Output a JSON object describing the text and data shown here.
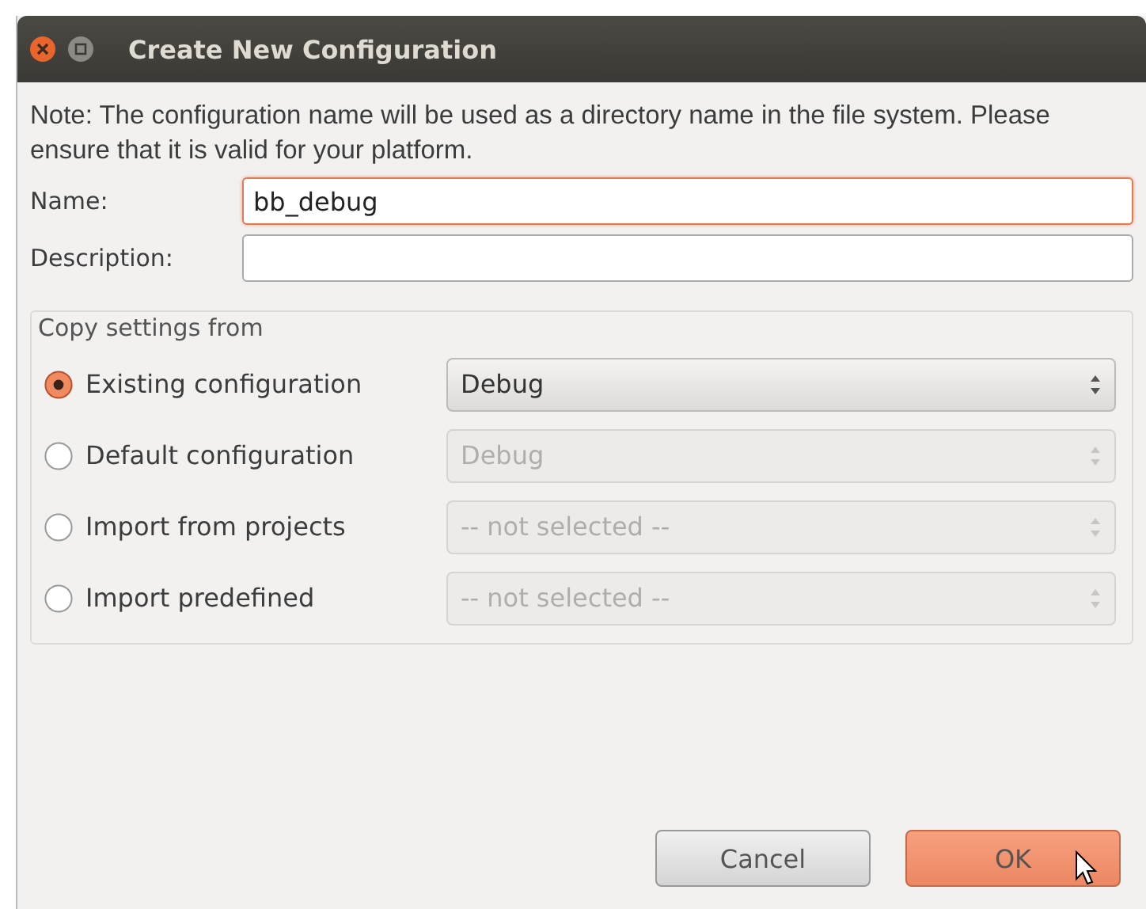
{
  "window": {
    "title": "Create New Configuration"
  },
  "note": "Note: The configuration name will be used as a directory name in the file system.  Please ensure that it is valid for your platform.",
  "fields": [
    {
      "label": "Name:",
      "value": "bb_debug",
      "focused": true
    },
    {
      "label": "Description:",
      "focused": false
    }
  ],
  "copy_settings": {
    "title": "Copy settings from",
    "options": [
      {
        "label": "Existing configuration",
        "selected": true,
        "combo": {
          "value": "Debug",
          "disabled": false
        }
      },
      {
        "label": "Default configuration",
        "selected": false,
        "combo": {
          "value": "Debug",
          "disabled": true
        }
      },
      {
        "label": "Import from projects",
        "selected": false,
        "combo": {
          "value": "-- not selected --",
          "disabled": true
        }
      },
      {
        "label": "Import predefined",
        "selected": false,
        "combo": {
          "value": "-- not selected --",
          "disabled": true
        }
      }
    ]
  },
  "buttons": [
    {
      "label": "Cancel",
      "default": false
    },
    {
      "label": "OK",
      "default": true
    }
  ]
}
